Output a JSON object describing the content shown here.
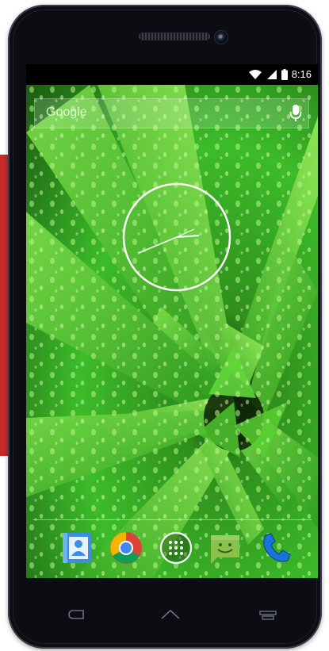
{
  "status_bar": {
    "time": "8:16",
    "icons": [
      "wifi-icon",
      "signal-icon",
      "battery-icon"
    ]
  },
  "search": {
    "label": "Google"
  },
  "clock_widget": {
    "type": "analog-clock",
    "hour": 8,
    "minute": 16
  },
  "dock": {
    "apps": [
      "contacts-icon",
      "chrome-icon",
      "app-drawer-icon",
      "messaging-icon",
      "phone-icon"
    ]
  },
  "navigation": {
    "buttons": [
      "back-icon",
      "home-icon",
      "recent-apps-icon"
    ]
  },
  "colors": {
    "wallpaper_green": "#3fbf2a",
    "phone_body": "#0c0d12",
    "accent_red": "#c62a2a"
  }
}
